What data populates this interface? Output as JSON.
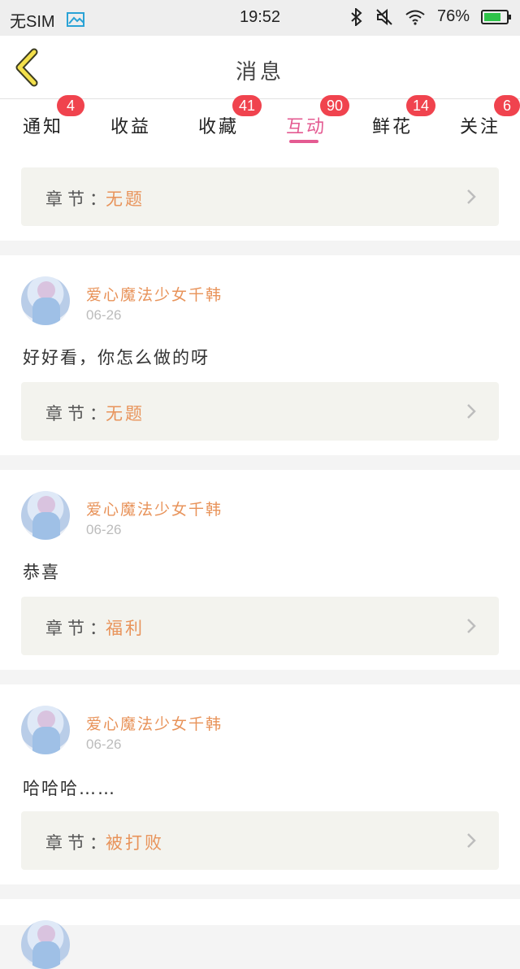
{
  "status_bar": {
    "carrier": "无SIM",
    "time": "19:52",
    "battery": "76%",
    "battery_level": 0.76,
    "icons": [
      "gallery-icon",
      "bluetooth-icon",
      "mute-icon",
      "wifi-icon",
      "battery-icon"
    ]
  },
  "header": {
    "back_icon": "chevron-left-icon",
    "title": "消息"
  },
  "tabs": [
    {
      "label": "通知",
      "badge": "4",
      "active": false
    },
    {
      "label": "收益",
      "badge": "",
      "active": false
    },
    {
      "label": "收藏",
      "badge": "41",
      "active": false
    },
    {
      "label": "互动",
      "badge": "90",
      "active": true
    },
    {
      "label": "鲜花",
      "badge": "14",
      "active": false
    },
    {
      "label": "关注",
      "badge": "6",
      "active": false
    }
  ],
  "colors": {
    "accent": "#e45b92",
    "badge": "#f0434e",
    "username": "#e8935a",
    "chapter_box": "#f3f3ee"
  },
  "first_item": {
    "chapter_prefix": "章节：",
    "chapter": "无题"
  },
  "messages": [
    {
      "username": "爱心魔法少女千韩",
      "date": "06-26",
      "comment": "好好看，你怎么做的呀",
      "chapter_prefix": "章节：",
      "chapter": "无题"
    },
    {
      "username": "爱心魔法少女千韩",
      "date": "06-26",
      "comment": "恭喜",
      "chapter_prefix": "章节：",
      "chapter": "福利"
    },
    {
      "username": "爱心魔法少女千韩",
      "date": "06-26",
      "comment": "哈哈哈……",
      "chapter_prefix": "章节：",
      "chapter": "被打败"
    }
  ]
}
